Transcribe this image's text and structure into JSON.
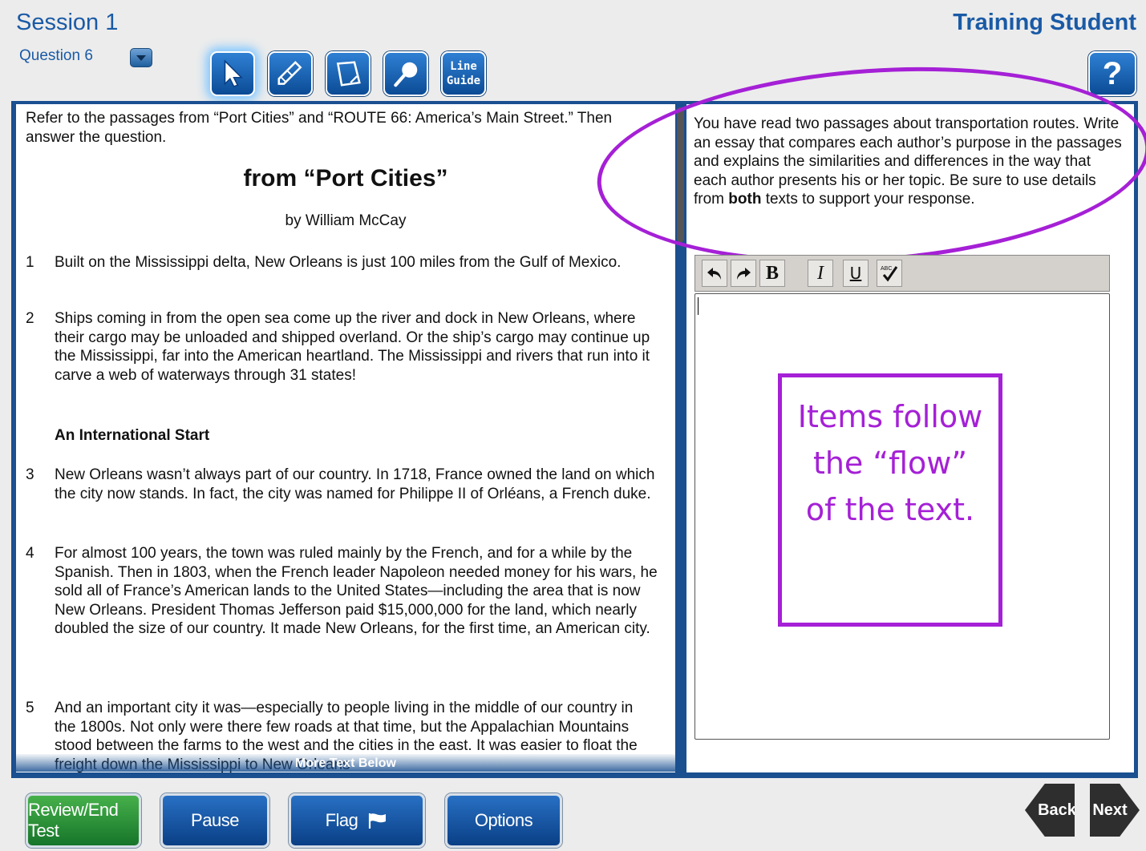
{
  "header": {
    "session": "Session 1",
    "question": "Question 6",
    "student_name": "Training Student",
    "help": "?"
  },
  "tools": {
    "line_guide_line1": "Line",
    "line_guide_line2": "Guide"
  },
  "passage": {
    "intro": "Refer to the passages from “Port Cities” and “ROUTE 66: America’s Main Street.” Then answer the question.",
    "title": "from “Port Cities”",
    "byline": "by William McCay",
    "subheading": "An International Start",
    "paragraphs": [
      {
        "num": "1",
        "text": "Built on the Mississippi delta, New Orleans is just 100 miles from the Gulf of Mexico."
      },
      {
        "num": "2",
        "text": "Ships coming in from the open sea come up the river and dock in New Orleans, where their cargo may be unloaded and shipped overland. Or the ship’s cargo may continue up the Mississippi, far into the American heartland. The Mississippi and rivers that run into it carve a web of waterways through 31 states!"
      },
      {
        "num": "3",
        "text": "New Orleans wasn’t always part of our country. In 1718, France owned the land on which the city now stands. In fact, the city was named for Philippe II of Orléans, a French duke."
      },
      {
        "num": "4",
        "text": "For almost 100 years, the town was ruled mainly by the French, and for a while by the Spanish. Then in 1803, when the French leader Napoleon needed money for his wars, he sold all of France’s American lands to the United States—including the area that is now New Orleans. President Thomas Jefferson paid $15,000,000 for the land, which nearly doubled the size of our country. It made New Orleans, for the first time, an American city."
      },
      {
        "num": "5",
        "text": "And an important city it was—especially to people living in the middle of our country in the 1800s. Not only were there few roads at that time, but the Appalachian Mountains stood between the farms to the west and the cities in the east. It was easier to float the freight down the Mississippi to New Orleans"
      }
    ],
    "more_text": "More Text Below"
  },
  "question": {
    "prompt_before_bold": "You have read two passages about transportation routes. Write an essay that compares each author’s purpose in the passages and explains the similarities and differences in the way that each author presents his or her topic. Be sure to use details from ",
    "prompt_bold": "both",
    "prompt_after_bold": " texts to support your response."
  },
  "editor_toolbar": {
    "bold": "B",
    "italic": "I",
    "underline": "U",
    "spellcheck_label": "ABC"
  },
  "annotation": {
    "callout_line1": "Items follow",
    "callout_line2": "the “flow”",
    "callout_line3": "of the text.",
    "accent_color": "#a520d6"
  },
  "footer": {
    "review_end": "Review/End Test",
    "pause": "Pause",
    "flag": "Flag",
    "options": "Options",
    "back": "Back",
    "next": "Next"
  }
}
